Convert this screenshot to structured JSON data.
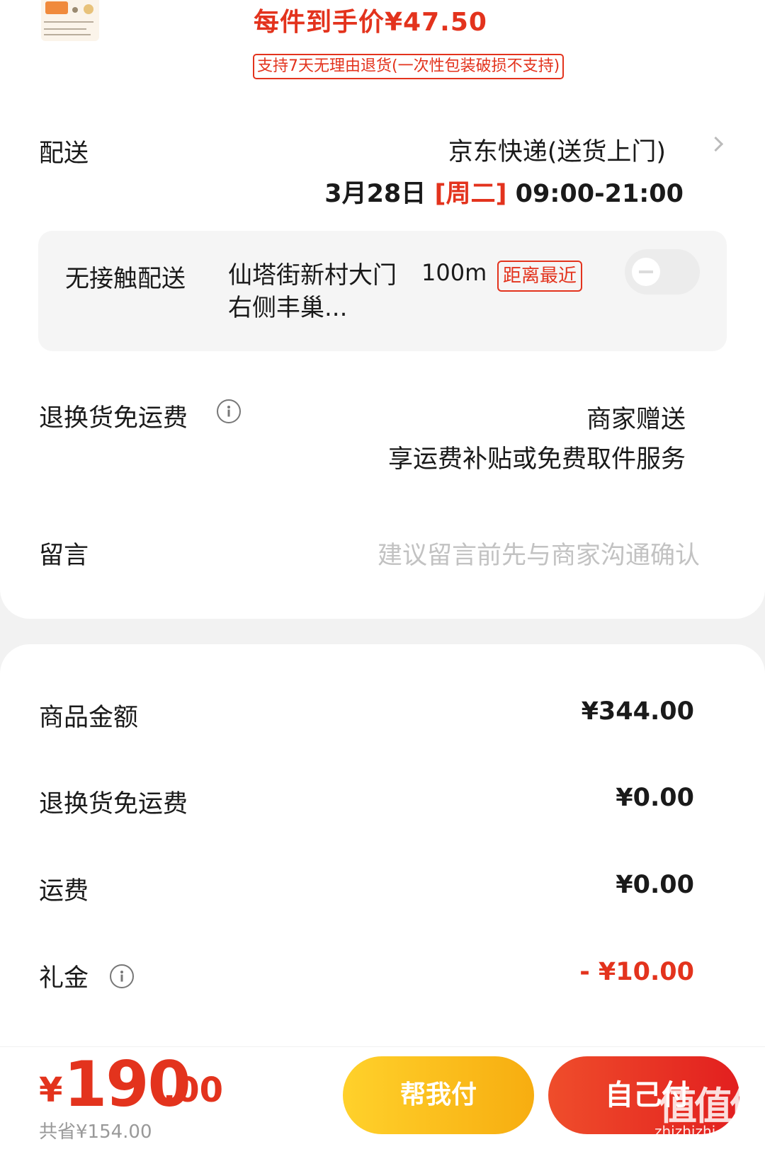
{
  "product": {
    "unit_price_text": "每件到手价¥47.50",
    "return_policy_tag": "支持7天无理由退货(一次性包装破损不支持)"
  },
  "delivery": {
    "label": "配送",
    "method": "京东快递(送货上门)",
    "date": "3月28日",
    "weekday": "[周二]",
    "time_window": "09:00-21:00"
  },
  "contactless": {
    "label": "无接触配送",
    "address": "仙塔街新村大门右侧丰巢...",
    "distance": "100m",
    "badge": "距离最近",
    "enabled": false
  },
  "return_shipping": {
    "label": "退换货免运费",
    "value_line1": "商家赠送",
    "value_line2": "享运费补贴或免费取件服务"
  },
  "message": {
    "label": "留言",
    "placeholder": "建议留言前先与商家沟通确认"
  },
  "summary": {
    "items": [
      {
        "label": "商品金额",
        "value": "¥344.00"
      },
      {
        "label": "退换货免运费",
        "value": "¥0.00"
      },
      {
        "label": "运费",
        "value": "¥0.00"
      },
      {
        "label": "礼金",
        "value": "- ¥10.00"
      }
    ]
  },
  "footer": {
    "total_yen": "¥",
    "total_int": "190",
    "total_dec": ".00",
    "saved": "共省¥154.00",
    "help_pay_button": "帮我付",
    "self_pay_button": "自己付"
  },
  "watermark": {
    "main": "值值值",
    "sub": "zhizhizhi.com"
  },
  "colors": {
    "accent_red": "#e3331d",
    "help_button_yellow": "#f7ad10"
  }
}
